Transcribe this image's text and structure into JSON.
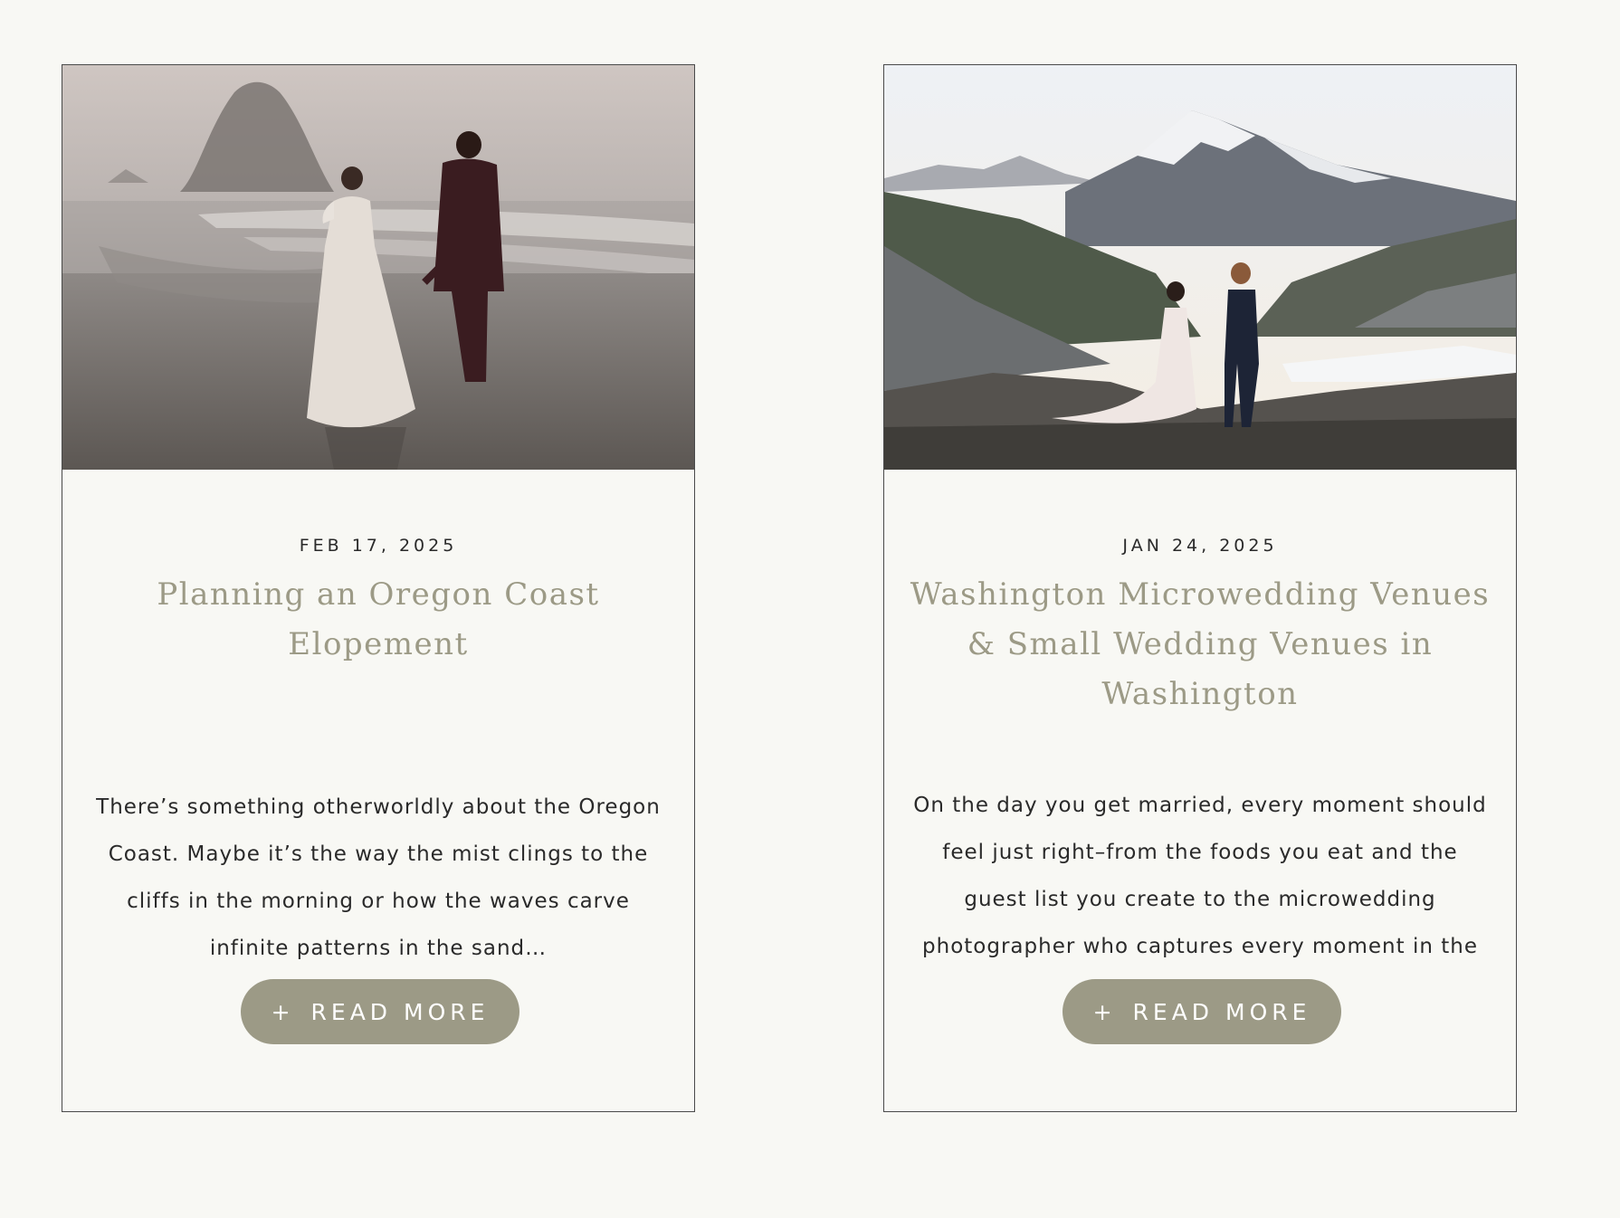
{
  "posts": [
    {
      "date": "FEB 17, 2025",
      "title": "Planning an Oregon Coast Elopement",
      "excerpt": "There’s something otherworldly about the Oregon Coast. Maybe it’s the way the mist clings to the cliffs in the morning or how the waves carve infinite patterns in the sand…",
      "button_icon": "+",
      "button_label": "READ MORE"
    },
    {
      "date": "JAN 24, 2025",
      "title": "Washington Microwedding Venues & Small Wedding Venues in Washington",
      "excerpt": "On the day you get married, every moment should feel just right–from the foods you eat and the guest list you create to the microwedding photographer who captures every moment in the",
      "button_icon": "+",
      "button_label": "READ MORE"
    }
  ],
  "colors": {
    "background": "#f8f8f4",
    "accent": "#9c9a86",
    "text": "#2a2a2a",
    "border": "#4a4a4a"
  }
}
